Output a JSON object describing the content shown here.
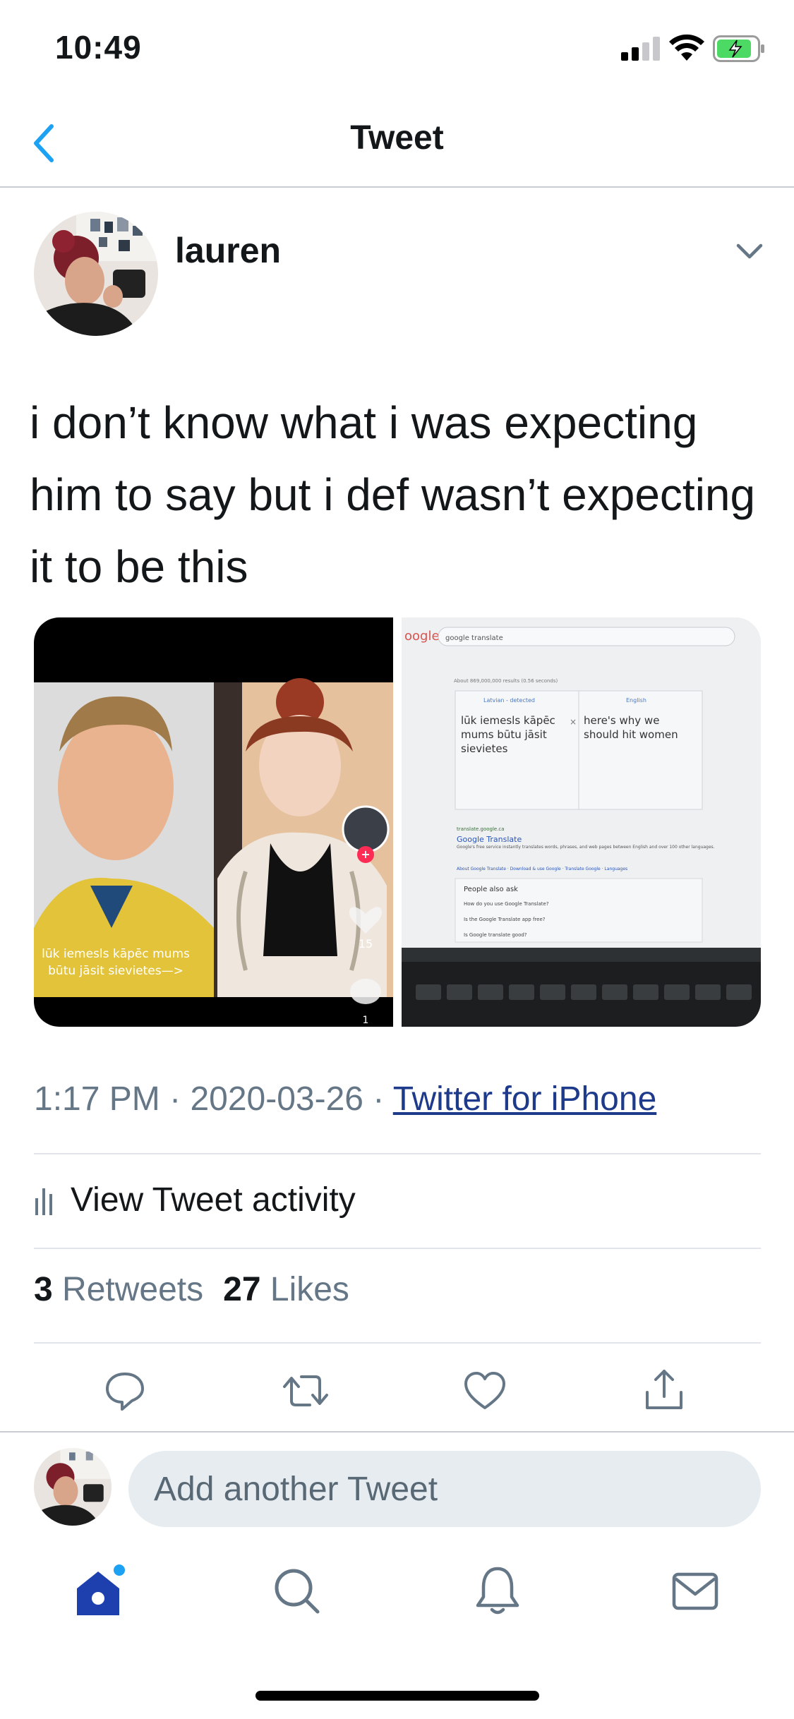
{
  "status_bar": {
    "time": "10:49"
  },
  "nav": {
    "title": "Tweet"
  },
  "tweet": {
    "author_name": "lauren",
    "text": "i don’t know what i was expecting him to say but i def wasn’t expecting it to be this",
    "time": "1:17 PM",
    "date": "2020-03-26",
    "source": "Twitter for iPhone",
    "separator": "·"
  },
  "media": {
    "left": {
      "caption_line1": "lūk iemesls kāpēc mums",
      "caption_line2": "būtu jāsit sievietes—>",
      "like_count": "15",
      "comment_count": "1"
    },
    "right": {
      "search_query": "google translate",
      "logo_fragment": "oogle",
      "result_count": "About 869,000,000 results (0.56 seconds)",
      "source_lang": "Latvian - detected",
      "target_lang": "English",
      "source_text": "lūk iemesls kāpēc mums būtu jāsit sievietes",
      "translated_text": "here's why we should hit women",
      "result_url": "translate.google.ca",
      "result_title": "Google Translate",
      "result_desc": "Google's free service instantly translates words, phrases, and web pages between English and over 100 other languages.",
      "result_links": "About Google Translate · Download & use Google · Translate Google · Languages",
      "paa_title": "People also ask",
      "paa_q1": "How do you use Google Translate?",
      "paa_q2": "Is the Google Translate app free?",
      "paa_q3": "Is Google translate good?"
    }
  },
  "activity": {
    "label": "View Tweet activity"
  },
  "stats": {
    "retweets_count": "3",
    "retweets_label": "Retweets",
    "likes_count": "27",
    "likes_label": "Likes"
  },
  "compose": {
    "placeholder": "Add another Tweet"
  },
  "colors": {
    "accent": "#1da1f2",
    "link": "#1e3a8a",
    "secondary_text": "#657786",
    "tab_active": "#1e40af",
    "battery_green": "#4cd964"
  },
  "icons": {
    "back": "chevron-left-icon",
    "more": "chevron-down-icon",
    "reply": "comment-icon",
    "retweet": "retweet-icon",
    "like": "heart-icon",
    "share": "share-icon",
    "activity": "bar-chart-icon",
    "home": "home-icon",
    "search": "search-icon",
    "notifications": "bell-icon",
    "messages": "mail-icon"
  }
}
